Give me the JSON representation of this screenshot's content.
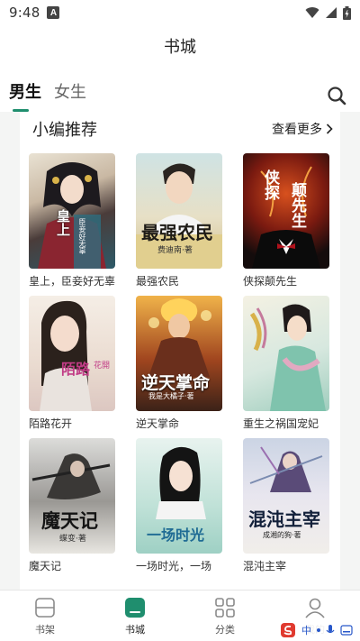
{
  "status_bar": {
    "time": "9:48",
    "notification_letter": "A"
  },
  "header": {
    "title": "书城"
  },
  "tabs": [
    {
      "label": "男生",
      "active": true
    },
    {
      "label": "女生",
      "active": false
    }
  ],
  "section": {
    "title": "小编推荐",
    "more_label": "查看更多"
  },
  "books": [
    {
      "title": "皇上，臣妾好无辜",
      "cover_text": "皇上",
      "cover_sub": "臣妾好无辜"
    },
    {
      "title": "最强农民",
      "cover_text": "最强农民",
      "cover_sub": "费迪南·著"
    },
    {
      "title": "侠探颠先生",
      "cover_text": "侠探",
      "cover_sub": "颠先生"
    },
    {
      "title": "陌路花开",
      "cover_text": "陌路",
      "cover_sub": "花開"
    },
    {
      "title": "逆天掌命",
      "cover_text": "逆天掌命",
      "cover_sub": "我是大橘子·著"
    },
    {
      "title": "重生之祸国宠妃",
      "cover_text": "",
      "cover_sub": ""
    },
    {
      "title": "魔天记",
      "cover_text": "魔天记",
      "cover_sub": "蝶变·著"
    },
    {
      "title": "一场时光，一场",
      "cover_text": "一场时光",
      "cover_sub": ""
    },
    {
      "title": "混沌主宰",
      "cover_text": "混沌主宰",
      "cover_sub": "成湘的狗·著"
    }
  ],
  "bottom_nav": [
    {
      "label": "书架",
      "icon": "bookshelf-icon",
      "active": false
    },
    {
      "label": "书城",
      "icon": "bookstore-icon",
      "active": true
    },
    {
      "label": "分类",
      "icon": "category-icon",
      "active": false
    },
    {
      "label": "我的",
      "icon": "profile-icon",
      "active": false
    }
  ],
  "ime": {
    "label": "中"
  },
  "colors": {
    "accent": "#1f8e6e"
  }
}
